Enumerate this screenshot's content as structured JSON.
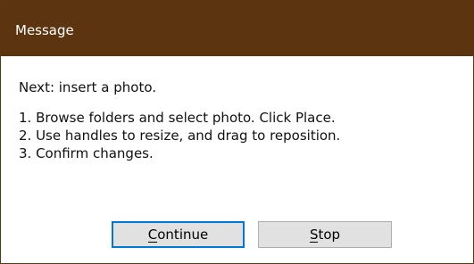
{
  "window": {
    "title": "Message"
  },
  "message": {
    "heading": "Next: insert a photo.",
    "steps": [
      "1. Browse folders and select photo. Click Place.",
      "2. Use handles to resize, and drag to reposition.",
      "3. Confirm changes."
    ]
  },
  "buttons": {
    "continue": {
      "accelerator": "C",
      "rest": "ontinue"
    },
    "stop": {
      "accelerator": "S",
      "rest": "top"
    }
  },
  "colors": {
    "titlebar": "#5c3410",
    "focus_border": "#0078d7",
    "button_face": "#e1e1e1"
  }
}
